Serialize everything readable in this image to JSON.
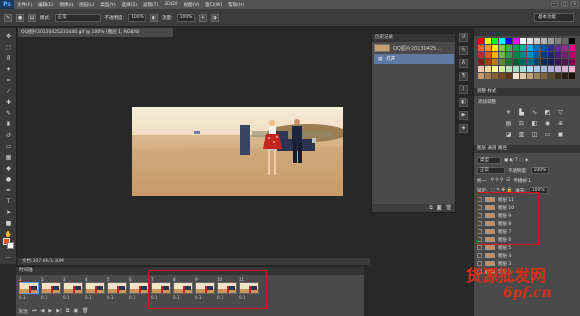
{
  "app": {
    "logo": "Ps"
  },
  "menu": [
    "文件(F)",
    "编辑(E)",
    "图像(I)",
    "图层(L)",
    "类型(Y)",
    "选择(S)",
    "滤镜(T)",
    "3D(D)",
    "视图(V)",
    "窗口(W)",
    "帮助(H)"
  ],
  "window_controls": [
    "—",
    "□",
    "×"
  ],
  "options_bar": {
    "mode_label": "模式:",
    "mode_value": "正常",
    "opacity_label": "不透明度:",
    "opacity_value": "100%",
    "flow_label": "流量:",
    "flow_value": "100%",
    "workspace": "基本功能"
  },
  "document_tab": "QQ图片20130425233446.gif @ 100% (图层 1, RGB/8)",
  "status_bar": "文档:307.6K/3.30M",
  "history_panel": {
    "tabs": "历史记录",
    "snapshot_name": "QQ图片20130425...",
    "step": "打开"
  },
  "adjustments_panel": {
    "tabs": "调整   样式",
    "title": "添加调整"
  },
  "layers_panel": {
    "tabs": "图层   通道   路径",
    "kind_label": "类型",
    "blend": "正常",
    "opacity_label": "不透明度:",
    "opacity": "100%",
    "unify_label": "统一:",
    "propagate_label": "传播帧 1",
    "lock_label": "锁定:",
    "fill_label": "填充:",
    "fill": "100%",
    "layers": [
      "图层 11",
      "图层 10",
      "图层 9",
      "图层 8",
      "图层 7",
      "图层 6",
      "图层 5",
      "图层 4",
      "图层 3",
      "图层 2"
    ]
  },
  "timeline": {
    "tab": "时间轴",
    "frames": [
      {
        "num": "1",
        "time": "0.1"
      },
      {
        "num": "2",
        "time": "0.1"
      },
      {
        "num": "3",
        "time": "0.1"
      },
      {
        "num": "4",
        "time": "0.1"
      },
      {
        "num": "5",
        "time": "0.1"
      },
      {
        "num": "6",
        "time": "0.1"
      },
      {
        "num": "7",
        "time": "0.1"
      },
      {
        "num": "8",
        "time": "0.1"
      },
      {
        "num": "9",
        "time": "0.1"
      },
      {
        "num": "10",
        "time": "0.1"
      },
      {
        "num": "11",
        "time": "0.1"
      }
    ],
    "loop": "永远"
  },
  "watermark": {
    "line1": "货源批发网",
    "line2": "6pf.cn"
  },
  "colors": {
    "highlight": "#e0101a",
    "selection": "#5f7aa3",
    "foreground": "#e0501e"
  }
}
